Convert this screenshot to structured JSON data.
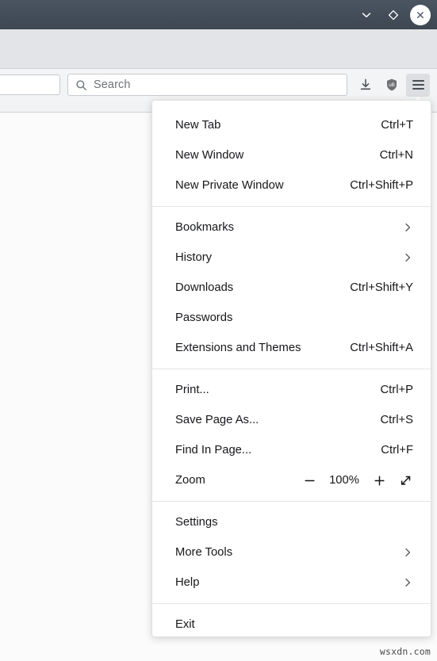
{
  "window": {
    "titlebar": {
      "minimize_icon": "chevron-down-icon",
      "maximize_icon": "diamond-icon",
      "close_icon": "close-icon"
    }
  },
  "toolbar": {
    "urlbar": {
      "value": "",
      "placeholder": ""
    },
    "search": {
      "value": "",
      "placeholder": "Search",
      "icon": "search-icon"
    },
    "icons": [
      {
        "name": "downloads-icon",
        "label": "Downloads"
      },
      {
        "name": "ublock-shield-icon",
        "label": "uB"
      }
    ],
    "menu_button": {
      "name": "hamburger-menu-icon",
      "label": "Open application menu"
    }
  },
  "menu": {
    "groups": [
      {
        "items": [
          {
            "label": "New Tab",
            "accel": "Ctrl+T",
            "type": "command"
          },
          {
            "label": "New Window",
            "accel": "Ctrl+N",
            "type": "command"
          },
          {
            "label": "New Private Window",
            "accel": "Ctrl+Shift+P",
            "type": "command"
          }
        ]
      },
      {
        "items": [
          {
            "label": "Bookmarks",
            "accel": "",
            "type": "submenu"
          },
          {
            "label": "History",
            "accel": "",
            "type": "submenu"
          },
          {
            "label": "Downloads",
            "accel": "Ctrl+Shift+Y",
            "type": "command"
          },
          {
            "label": "Passwords",
            "accel": "",
            "type": "command"
          },
          {
            "label": "Extensions and Themes",
            "accel": "Ctrl+Shift+A",
            "type": "command"
          }
        ]
      },
      {
        "items": [
          {
            "label": "Print...",
            "accel": "Ctrl+P",
            "type": "command"
          },
          {
            "label": "Save Page As...",
            "accel": "Ctrl+S",
            "type": "command"
          },
          {
            "label": "Find In Page...",
            "accel": "Ctrl+F",
            "type": "command"
          },
          {
            "label": "Zoom",
            "accel": "",
            "type": "zoom"
          }
        ]
      },
      {
        "items": [
          {
            "label": "Settings",
            "accel": "",
            "type": "command"
          },
          {
            "label": "More Tools",
            "accel": "",
            "type": "submenu"
          },
          {
            "label": "Help",
            "accel": "",
            "type": "submenu"
          }
        ]
      },
      {
        "items": [
          {
            "label": "Exit",
            "accel": "",
            "type": "command"
          }
        ]
      }
    ],
    "zoom": {
      "label": "Zoom",
      "level": "100%",
      "decrease_icon": "minus-icon",
      "increase_icon": "plus-icon",
      "fullscreen_icon": "expand-diagonal-icon"
    }
  },
  "watermark": {
    "text": "wsxdn.com"
  },
  "colors": {
    "titlebar_bg": "#434d59",
    "chrome_bg": "#e2e4e7",
    "navbar_bg": "#f3f4f5",
    "menu_bg": "#ffffff",
    "menu_text": "#16171a",
    "separator": "#e4e4e4",
    "placeholder_text": "#6f7479",
    "hamburger_active_bg": "#dcdee1"
  }
}
